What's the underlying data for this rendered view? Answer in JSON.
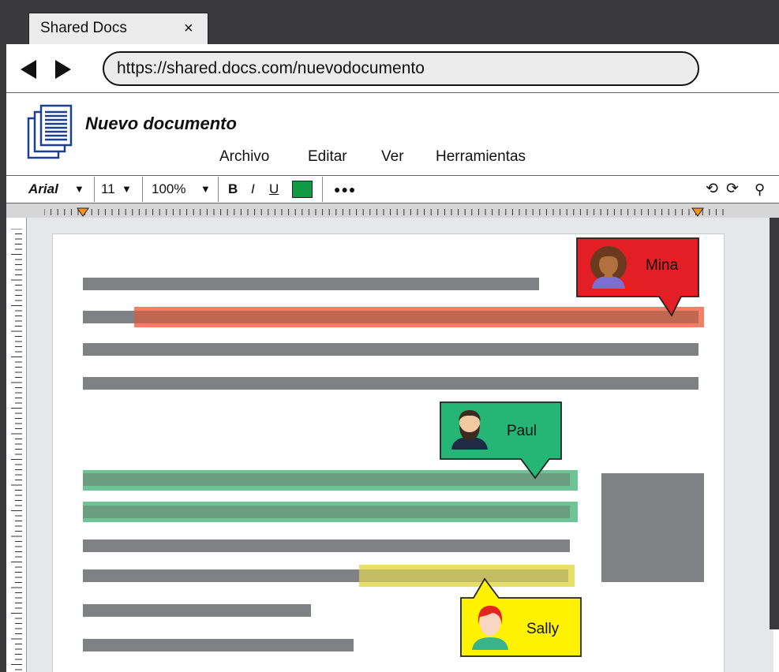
{
  "browser": {
    "tab_title": "Shared Docs",
    "tab_close": "×",
    "url": "https://shared.docs.com/nuevodocumento"
  },
  "app": {
    "document_title": "Nuevo documento",
    "menu": [
      "Archivo",
      "Editar",
      "Ver",
      "Herramientas"
    ],
    "toolbar": {
      "font": "Arial",
      "font_size": "11",
      "zoom": "100%",
      "bold": "B",
      "italic": "I",
      "underline": "U",
      "more": "●●●",
      "dropdown_glyph": "▼",
      "undo_icon": "⟲",
      "redo_icon": "⟳",
      "search_icon": "⚲"
    }
  },
  "collaborators": [
    {
      "name": "Mina",
      "color": "#e31e24",
      "highlight": "#ef6a4c"
    },
    {
      "name": "Paul",
      "color": "#25b574",
      "highlight": "#6fc495"
    },
    {
      "name": "Sally",
      "color": "#fff200",
      "highlight": "#e8df6a"
    }
  ],
  "colors": {
    "text_color_swatch": "#0f9a43",
    "chrome_dark": "#3a3a3c",
    "text_line": "#808184"
  }
}
